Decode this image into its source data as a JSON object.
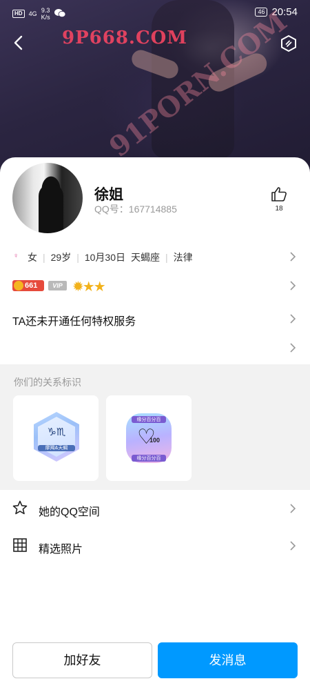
{
  "status_bar": {
    "hd": "HD",
    "signal": "4G",
    "speed": "9.3\nK/s",
    "speed_top": "9.3",
    "speed_bottom": "K/s",
    "battery": "46",
    "time": "20:54"
  },
  "header": {
    "back_icon": "chevron-left-icon",
    "settings_icon": "hexagon-settings-icon"
  },
  "profile": {
    "name": "徐姐",
    "qq_line": "QQ号：167714885",
    "likes": "18"
  },
  "info": {
    "gender": "女",
    "age": "29岁",
    "birthday": "10月30日",
    "zodiac": "天蝎座",
    "profession": "法律"
  },
  "badges": {
    "level": "661",
    "vip": "VIP"
  },
  "privilege": {
    "text": "TA还未开通任何特权服务"
  },
  "relationship": {
    "title": "你们的关系标识",
    "tags": [
      {
        "symbols": "♑♏",
        "label": "摩羯&天蝎"
      },
      {
        "top": "缘分百分百",
        "num": "100",
        "bottom": "缘分百分百"
      }
    ]
  },
  "menu": {
    "items": [
      {
        "label": "她的QQ空间",
        "icon": "star-icon"
      },
      {
        "label": "精选照片",
        "icon": "grid-icon"
      }
    ]
  },
  "actions": {
    "add_friend": "加好友",
    "send_message": "发消息"
  },
  "watermarks": {
    "wm1": "9P668.COM",
    "wm2": "91PORN.COM"
  },
  "colors": {
    "primary_button": "#0099ff",
    "level_badge": "#e64a3c",
    "vip_badge": "#b9b9b9",
    "star": "#f2b21b"
  }
}
